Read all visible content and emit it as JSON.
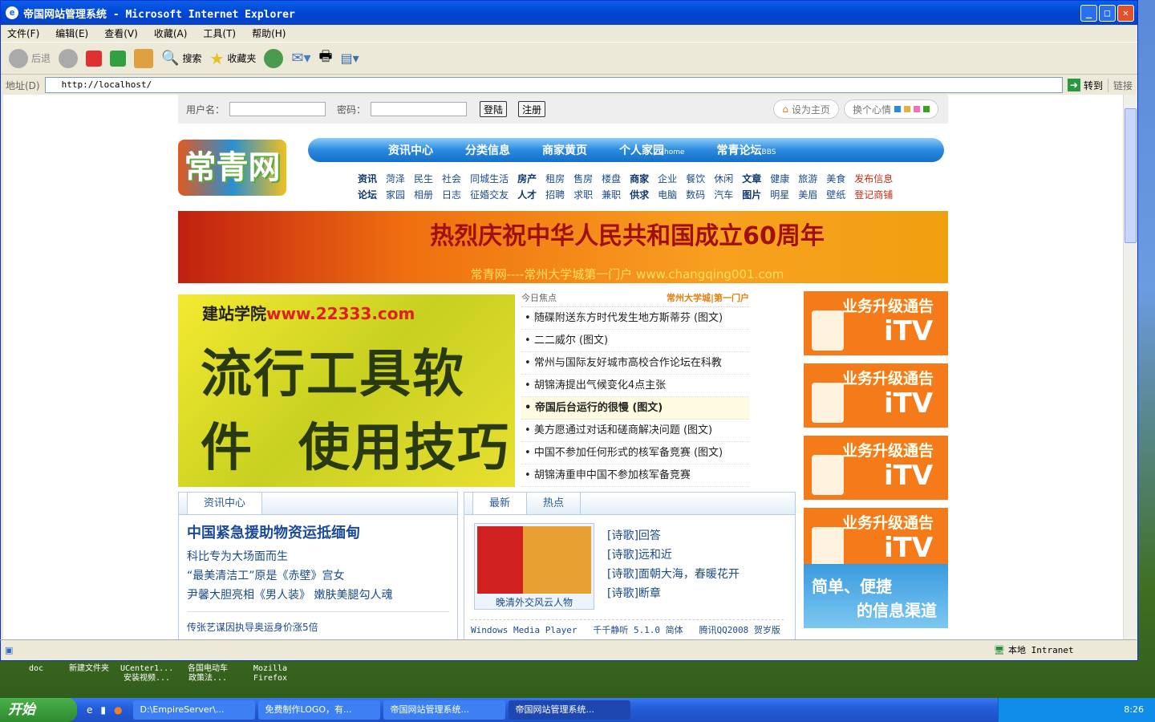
{
  "window": {
    "title": "帝国网站管理系统 - Microsoft Internet Explorer"
  },
  "menu": [
    "文件(F)",
    "编辑(E)",
    "查看(V)",
    "收藏(A)",
    "工具(T)",
    "帮助(H)"
  ],
  "toolbar": {
    "back": "后退",
    "search": "搜索",
    "favorites": "收藏夹"
  },
  "address": {
    "label": "地址(D)",
    "url": "http://localhost/",
    "go": "转到",
    "links": "链接"
  },
  "login": {
    "user_label": "用户名：",
    "pass_label": "密码：",
    "login": "登陆",
    "register": "注册",
    "set_home": "设为主页",
    "mood": "换个心情",
    "mood_colors": [
      "#2a8ae0",
      "#e8b040",
      "#f070c0",
      "#40a020"
    ]
  },
  "logo": "常青网",
  "nav": [
    {
      "label": "资讯中心",
      "sub": ""
    },
    {
      "label": "分类信息",
      "sub": ""
    },
    {
      "label": "商家黄页",
      "sub": ""
    },
    {
      "label": "个人家园",
      "sub": "home"
    },
    {
      "label": "常青论坛",
      "sub": "BBS"
    }
  ],
  "subnav": {
    "row1": [
      [
        "资讯",
        "b"
      ],
      [
        "菏泽",
        ""
      ],
      [
        "民生",
        ""
      ],
      [
        "社会",
        ""
      ],
      [
        "同城生活",
        ""
      ],
      [
        "房产",
        "b"
      ],
      [
        "租房",
        ""
      ],
      [
        "售房",
        ""
      ],
      [
        "楼盘",
        ""
      ],
      [
        "商家",
        "b"
      ],
      [
        "企业",
        ""
      ],
      [
        "餐饮",
        ""
      ],
      [
        "休闲",
        ""
      ],
      [
        "文章",
        "b"
      ],
      [
        "健康",
        ""
      ],
      [
        "旅游",
        ""
      ],
      [
        "美食",
        ""
      ],
      [
        "发布信息",
        "r"
      ]
    ],
    "row2": [
      [
        "论坛",
        "b"
      ],
      [
        "家园",
        ""
      ],
      [
        "相册",
        ""
      ],
      [
        "日志",
        ""
      ],
      [
        "征婚交友",
        ""
      ],
      [
        "人才",
        "b"
      ],
      [
        "招聘",
        ""
      ],
      [
        "求职",
        ""
      ],
      [
        "兼职",
        ""
      ],
      [
        "供求",
        "b"
      ],
      [
        "电脑",
        ""
      ],
      [
        "数码",
        ""
      ],
      [
        "汽车",
        ""
      ],
      [
        "图片",
        "b"
      ],
      [
        "明星",
        ""
      ],
      [
        "美眉",
        ""
      ],
      [
        "壁纸",
        ""
      ],
      [
        "登记商铺",
        "r"
      ]
    ]
  },
  "banner": {
    "title": "热烈庆祝中华人民共和国成立60周年",
    "subtitle": "常青网----常州大学城第一门户 www.changqing001.com"
  },
  "flash": {
    "site": "建站学院",
    "url": "www.22333.com",
    "line1": "流行工具软件",
    "line2": "使用技巧"
  },
  "focus": {
    "label": "今日焦点",
    "tag": "常州大学城|第一门户",
    "items": [
      "随碟附送东方时代发生地方斯蒂芬 (图文)",
      "二二威尔 (图文)",
      "常州与国际友好城市高校合作论坛在科教",
      "胡锦涛提出气候变化4点主张",
      "帝国后台运行的很慢 (图文)",
      "美方愿通过对话和磋商解决问题 (图文)",
      "中国不参加任何形式的核军备竞赛 (图文)",
      "胡锦涛重申中国不参加核军备竞赛"
    ]
  },
  "ads": [
    {
      "title": "业务升级通告",
      "brand": "iTV"
    },
    {
      "title": "业务升级通告",
      "brand": "iTV"
    },
    {
      "title": "业务升级通告",
      "brand": "iTV"
    },
    {
      "title": "业务升级通告",
      "brand": "iTV"
    }
  ],
  "ad_info": {
    "line1": "简单、便捷",
    "line2": "的信息渠道"
  },
  "news": {
    "tab": "资讯中心",
    "headline": "中国紧急援助物资运抵缅甸",
    "items": [
      "科比专为大场面而生",
      "“最美清洁工”原是《赤壁》宫女",
      "尹馨大胆亮相《男人装》 嫩肤美腿勾人魂"
    ],
    "more": "传张艺谋因执导奥运身价涨5倍"
  },
  "latest": {
    "tabs": [
      "最新",
      "热点"
    ],
    "book": "晚清外交风云人物",
    "items": [
      "[诗歌]回答",
      "[诗歌]远和近",
      "[诗歌]面朝大海，春暖花开",
      "[诗歌]断章"
    ],
    "downloads": "Windows Media Player   千千静听 5.1.0 简体   腾讯QQ2008 贺岁版"
  },
  "status": {
    "zone": "本地 Intranet"
  },
  "desktop": [
    {
      "l1": "doc",
      "l2": ""
    },
    {
      "l1": "新建文件夹",
      "l2": ""
    },
    {
      "l1": "UCenter1...",
      "l2": "安装视频..."
    },
    {
      "l1": "各国电动车",
      "l2": "政策法..."
    },
    {
      "l1": "Mozilla",
      "l2": "Firefox"
    }
  ],
  "taskbar": {
    "start": "开始",
    "tasks": [
      "D:\\EmpireServer\\...",
      "免费制作LOGO，有...",
      "帝国网站管理系统...",
      "帝国网站管理系统..."
    ],
    "time": "8:26"
  }
}
